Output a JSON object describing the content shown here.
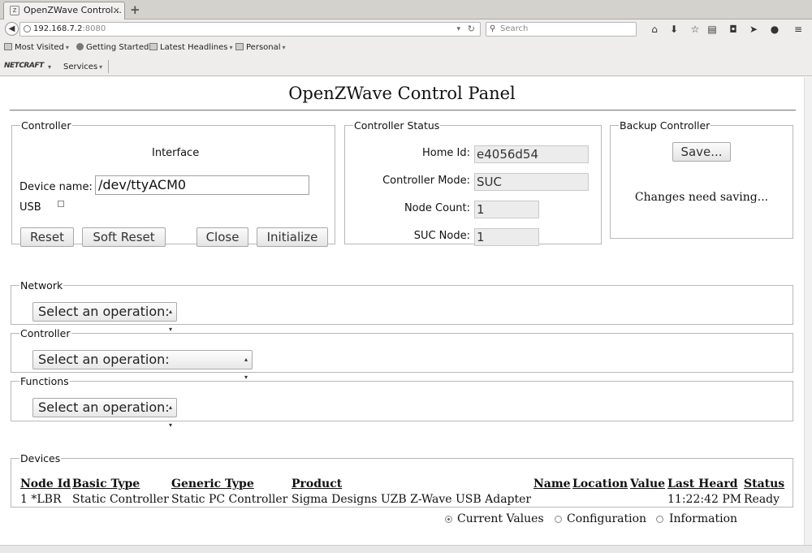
{
  "browser": {
    "tab_title": "OpenZWave Control...",
    "tab_close": "×",
    "new_tab": "+",
    "url_host": "192.168.7.2",
    "url_port": ":8080",
    "search_placeholder": "Search",
    "bookmarks": [
      {
        "label": "Most Visited",
        "has_menu": true
      },
      {
        "label": "Getting Started",
        "has_menu": false
      },
      {
        "label": "Latest Headlines",
        "has_menu": true
      },
      {
        "label": "Personal",
        "has_menu": true
      }
    ],
    "addon_logo": "NETCRAFT",
    "addon_services": "Services"
  },
  "page": {
    "title": "OpenZWave Control Panel",
    "controller": {
      "legend": "Controller",
      "interface_label": "Interface",
      "device_name_label": "Device name:",
      "device_name_value": "/dev/ttyACM0",
      "usb_label": "USB",
      "usb_checked": false,
      "buttons": {
        "reset": "Reset",
        "soft_reset": "Soft Reset",
        "close": "Close",
        "initialize": "Initialize"
      }
    },
    "controller_status": {
      "legend": "Controller Status",
      "home_id_label": "Home Id:",
      "home_id_value": "e4056d54",
      "mode_label": "Controller Mode:",
      "mode_value": "SUC",
      "node_count_label": "Node Count:",
      "node_count_value": "1",
      "suc_node_label": "SUC Node:",
      "suc_node_value": "1"
    },
    "backup": {
      "legend": "Backup Controller",
      "save_label": "Save...",
      "message": "Changes need saving..."
    },
    "network": {
      "legend": "Network",
      "select_value": "Select an operation:"
    },
    "controller_ops": {
      "legend": "Controller",
      "select_value": "Select an operation:"
    },
    "functions": {
      "legend": "Functions",
      "select_value": "Select an operation:"
    },
    "devices": {
      "legend": "Devices",
      "headers": {
        "node_id": "Node Id",
        "basic_type": "Basic Type",
        "generic_type": "Generic Type",
        "product": "Product",
        "name": "Name",
        "location": "Location",
        "value": "Value",
        "last_heard": "Last Heard",
        "status": "Status"
      },
      "rows": [
        {
          "node_id": "1 *LBR",
          "basic_type": "Static Controller",
          "generic_type": "Static PC Controller",
          "product": "Sigma Designs UZB Z-Wave USB Adapter",
          "name": "",
          "location": "",
          "value": "",
          "last_heard": "11:22:42 PM",
          "status": "Ready"
        }
      ]
    },
    "view_options": [
      {
        "label": "Current Values",
        "selected": true
      },
      {
        "label": "Configuration",
        "selected": false
      },
      {
        "label": "Information",
        "selected": false
      }
    ]
  }
}
